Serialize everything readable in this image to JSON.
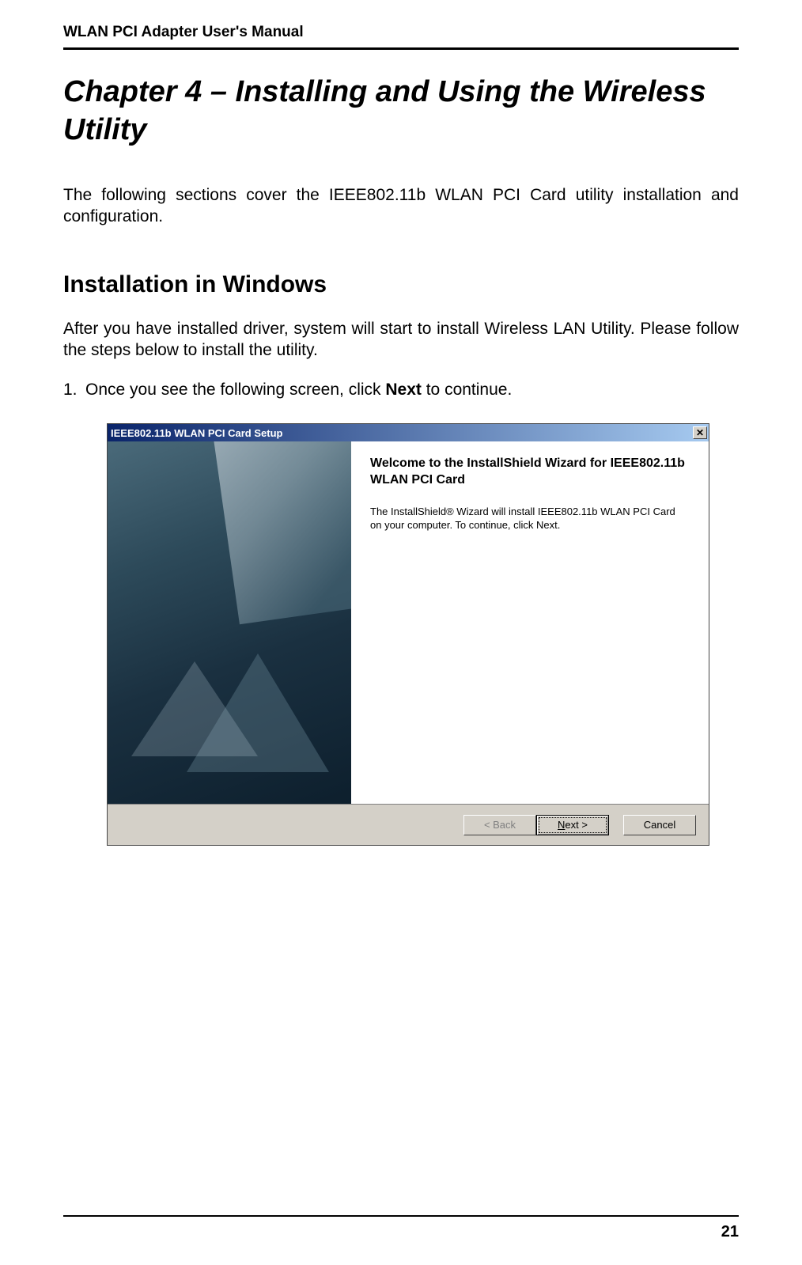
{
  "header": {
    "manual_title": "WLAN PCI Adapter User's Manual"
  },
  "main": {
    "chapter_title": "Chapter 4 – Installing and Using the Wireless Utility",
    "intro": "The following sections cover the IEEE802.11b WLAN PCI Card utility installation and configuration.",
    "section_heading": "Installation in Windows",
    "section_body": "After you have installed driver, system will start to install Wireless LAN Utility. Please follow the steps below to install the utility.",
    "step_number": "1.",
    "step_text_before": "Once you see the following screen, click ",
    "step_bold": "Next",
    "step_text_after": " to continue."
  },
  "wizard": {
    "title": "IEEE802.11b WLAN PCI Card Setup",
    "close_label": "✕",
    "welcome_heading": "Welcome to the InstallShield Wizard for IEEE802.11b WLAN PCI Card",
    "welcome_body": "The InstallShield® Wizard will install IEEE802.11b WLAN PCI Card on your computer.  To continue, click Next.",
    "buttons": {
      "back": "< Back",
      "next_underline": "N",
      "next_rest": "ext >",
      "cancel": "Cancel"
    }
  },
  "footer": {
    "page_number": "21"
  }
}
